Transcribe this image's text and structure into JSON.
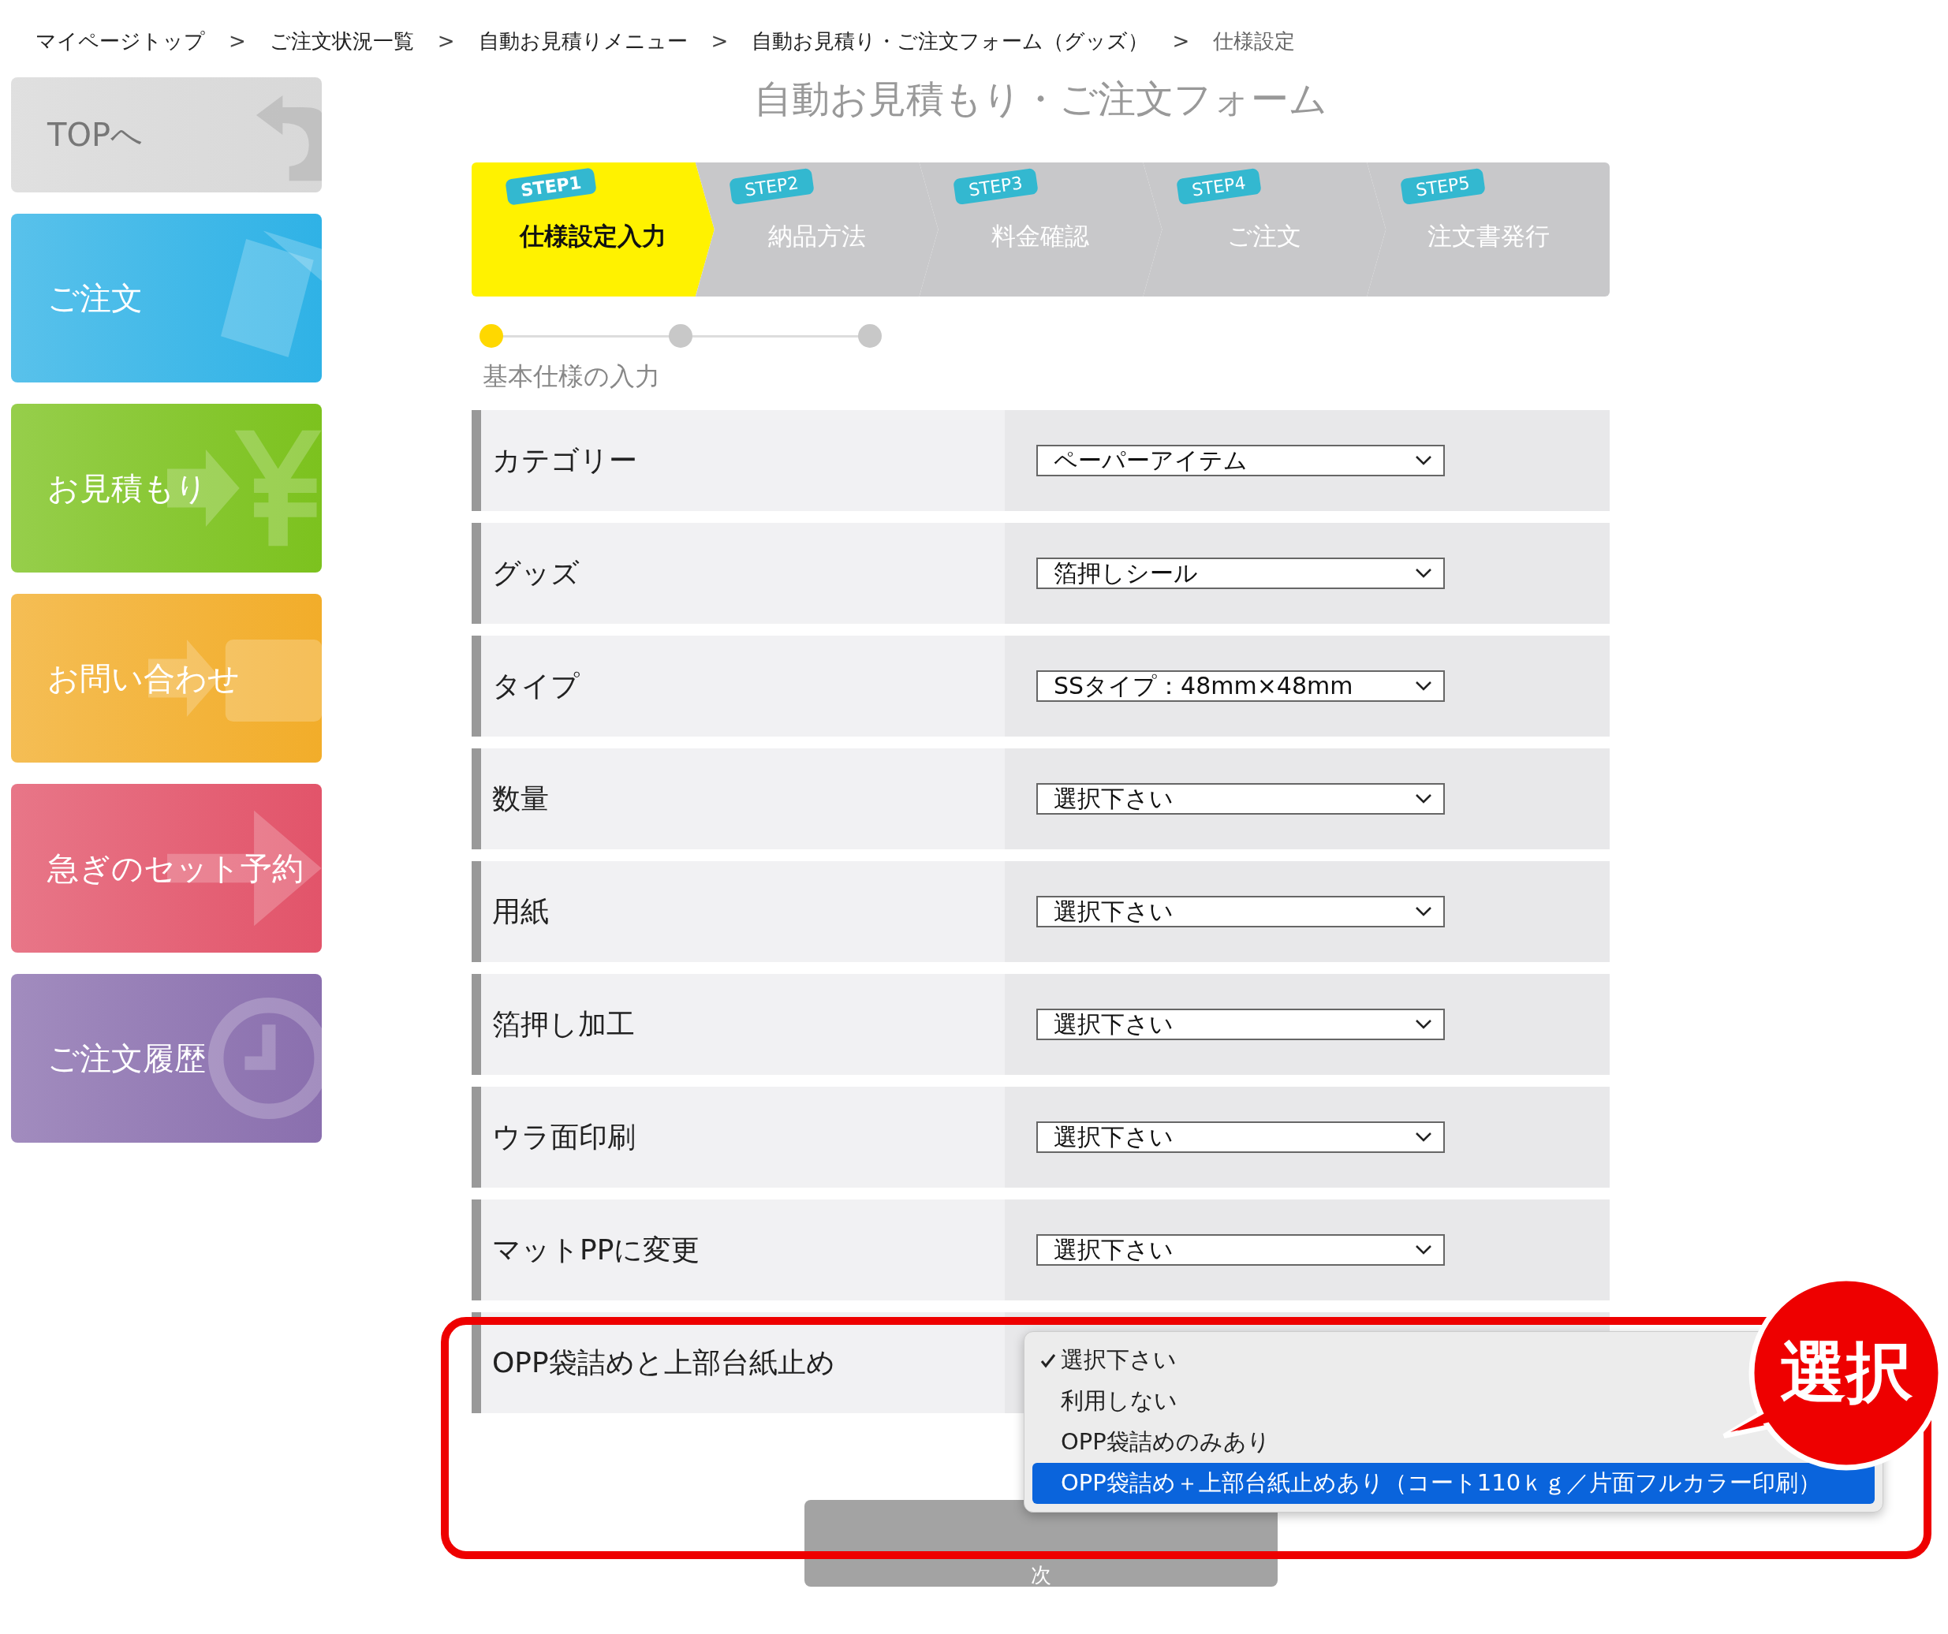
{
  "breadcrumb": {
    "separator": ">",
    "items": [
      "マイページトップ",
      "ご注文状況一覧",
      "自動お見積りメニュー",
      "自動お見積り・ご注文フォーム（グッズ）",
      "仕様設定"
    ]
  },
  "sidebar": {
    "items": [
      {
        "label": "TOPへ",
        "kind": "return",
        "color": "#d8d8d8"
      },
      {
        "label": "ご注文",
        "kind": "document",
        "color": "#2fb2e6"
      },
      {
        "label": "お見積もり",
        "kind": "yen",
        "color": "#7cc21e"
      },
      {
        "label": "お問い合わせ",
        "kind": "mail",
        "color": "#f2ad2a"
      },
      {
        "label": "急ぎのセット予約",
        "kind": "arrow",
        "color": "#e2546a"
      },
      {
        "label": "ご注文履歴",
        "kind": "clock",
        "color": "#8a6fae"
      }
    ]
  },
  "title": "自動お見積もり・ご注文フォーム",
  "steps": [
    {
      "tag": "STEP1",
      "label": "仕様設定入力",
      "selected": true
    },
    {
      "tag": "STEP2",
      "label": "納品方法",
      "selected": false
    },
    {
      "tag": "STEP3",
      "label": "料金確認",
      "selected": false
    },
    {
      "tag": "STEP4",
      "label": "ご注文",
      "selected": false
    },
    {
      "tag": "STEP5",
      "label": "注文書発行",
      "selected": false
    }
  ],
  "progress": {
    "dots": [
      {
        "selected": true
      },
      {
        "selected": false
      },
      {
        "selected": false
      }
    ],
    "label": "基本仕様の入力"
  },
  "rows": [
    {
      "kind": "select",
      "label": "カテゴリー",
      "value": "ペーパーアイテム"
    },
    {
      "kind": "select",
      "label": "グッズ",
      "value": "箔押しシール"
    },
    {
      "kind": "select",
      "label": "タイプ",
      "value": "SSタイプ：48mm×48mm"
    },
    {
      "kind": "select",
      "label": "数量",
      "value": "選択下さい"
    },
    {
      "kind": "select",
      "label": "用紙",
      "value": "選択下さい"
    },
    {
      "kind": "select",
      "label": "箔押し加工",
      "value": "選択下さい"
    },
    {
      "kind": "select",
      "label": "ウラ面印刷",
      "value": "選択下さい"
    },
    {
      "kind": "select",
      "label": "マットPPに変更",
      "value": "選択下さい"
    },
    {
      "kind": "menu",
      "label": "OPP袋詰めと上部台紙止め",
      "options": [
        {
          "label": "選択下さい",
          "checked": true,
          "selected": false
        },
        {
          "label": "利用しない",
          "checked": false,
          "selected": false
        },
        {
          "label": "OPP袋詰めのみあり",
          "checked": false,
          "selected": false
        },
        {
          "label": "OPP袋詰め＋上部台紙止めあり（コート110ｋｇ／片面フルカラー印刷）",
          "checked": false,
          "selected": true
        }
      ]
    }
  ],
  "next_button": "次",
  "callout": "選択"
}
